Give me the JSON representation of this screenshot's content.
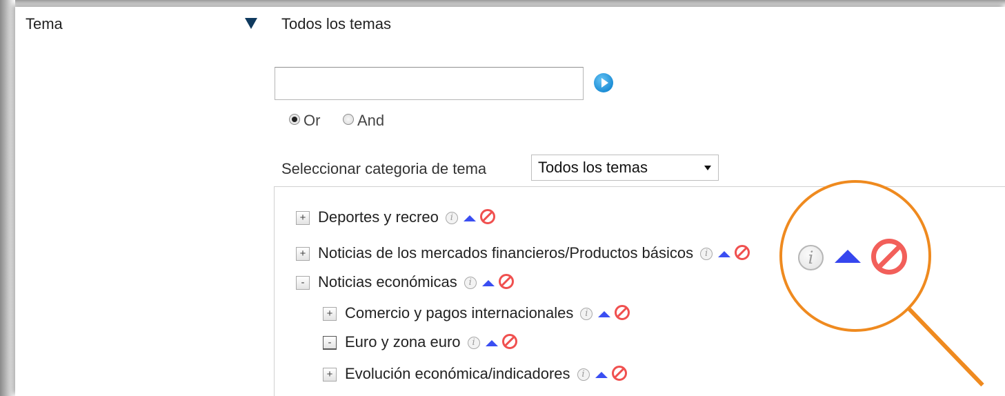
{
  "filter": {
    "label": "Tema",
    "selected_value": "Todos los temas"
  },
  "search": {
    "value": "",
    "mode_or": "Or",
    "mode_and": "And",
    "selected_mode": "Or"
  },
  "category": {
    "label": "Seleccionar categoria de tema",
    "selected": "Todos los temas"
  },
  "icons": {
    "expand": "+",
    "collapse": "-",
    "info_glyph": "i",
    "accent_up": "#3a4ef2",
    "accent_block": "#f0504f",
    "magnifier": "#ef8a1f"
  },
  "tree": [
    {
      "label": "Deportes y recreo",
      "state": "collapsed",
      "level": 0
    },
    {
      "label": "Noticias de los mercados financieros/Productos básicos",
      "state": "collapsed",
      "level": 0
    },
    {
      "label": "Noticias económicas",
      "state": "expanded",
      "level": 0
    },
    {
      "label": "Comercio y pagos internacionales",
      "state": "collapsed",
      "level": 1
    },
    {
      "label": "Euro y zona euro",
      "state": "expanded",
      "level": 1
    },
    {
      "label": "Evolución económica/indicadores",
      "state": "collapsed",
      "level": 1
    }
  ]
}
